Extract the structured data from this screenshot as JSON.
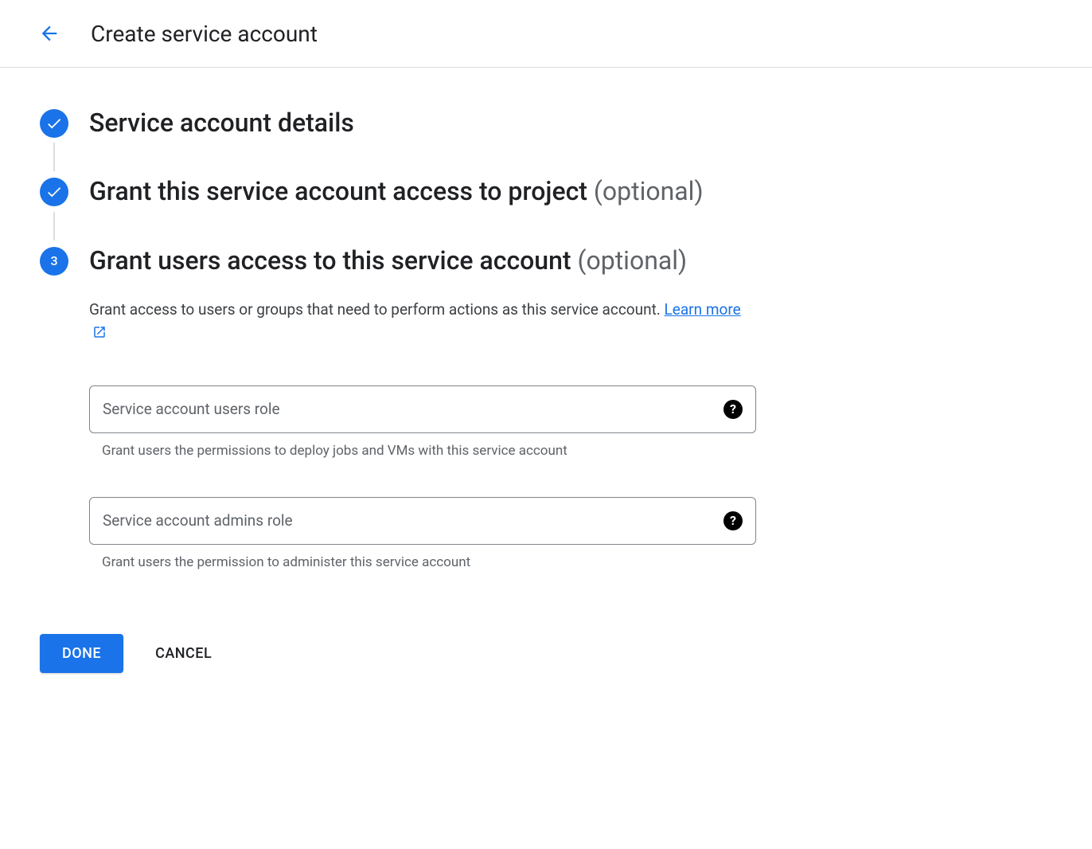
{
  "header": {
    "title": "Create service account"
  },
  "steps": {
    "step1": {
      "title": "Service account details"
    },
    "step2": {
      "title": "Grant this service account access to project",
      "optional": "(optional)"
    },
    "step3": {
      "number": "3",
      "title": "Grant users access to this service account",
      "optional": "(optional)",
      "description": "Grant access to users or groups that need to perform actions as this service account.",
      "learn_more": "Learn more"
    }
  },
  "inputs": {
    "users_role": {
      "placeholder": "Service account users role",
      "helper": "Grant users the permissions to deploy jobs and VMs with this service account"
    },
    "admins_role": {
      "placeholder": "Service account admins role",
      "helper": "Grant users the permission to administer this service account"
    }
  },
  "actions": {
    "done": "DONE",
    "cancel": "CANCEL"
  }
}
